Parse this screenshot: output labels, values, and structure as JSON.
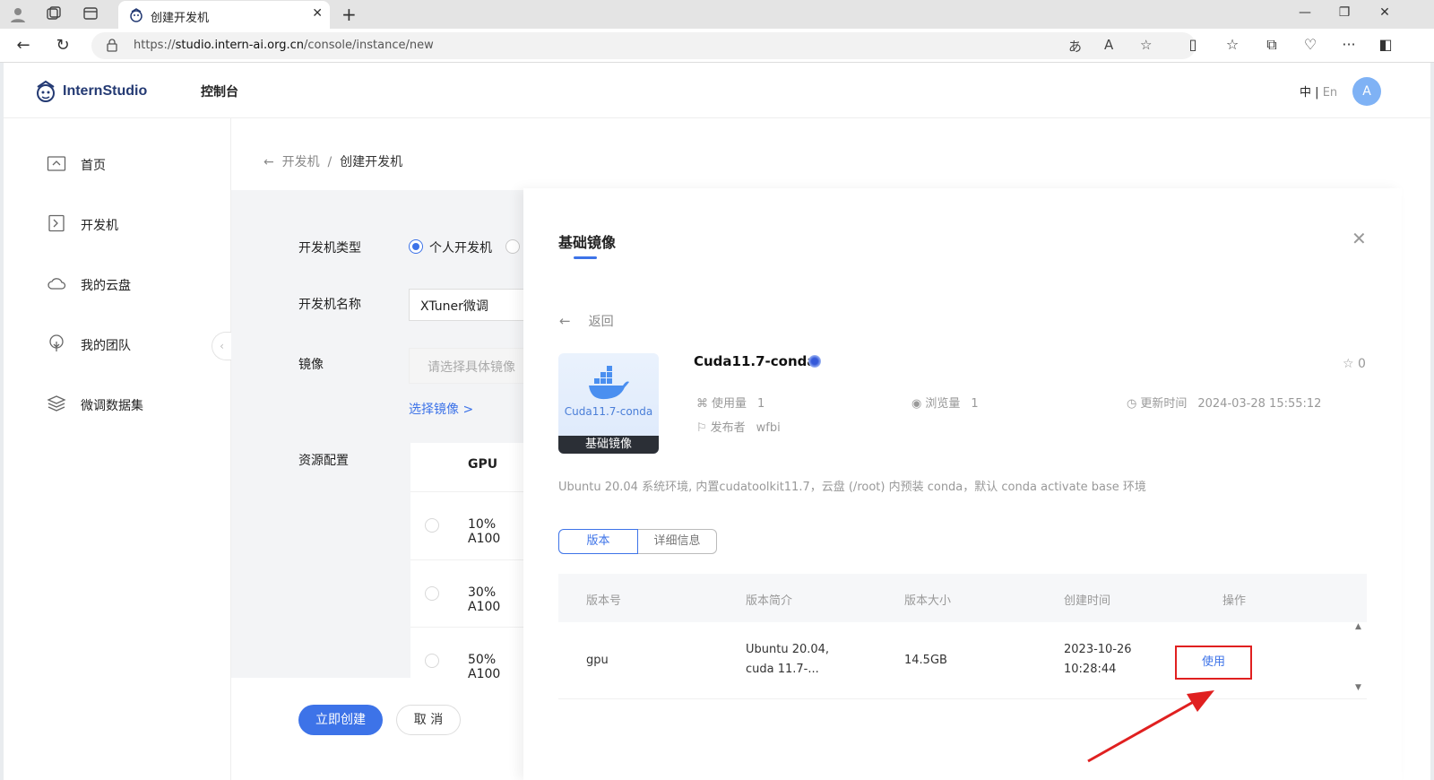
{
  "browser": {
    "tab_title": "创建开发机",
    "url_prefix": "https://",
    "url_host": "studio.intern-ai.org.cn",
    "url_path": "/console/instance/new"
  },
  "header": {
    "logo_text": "InternStudio",
    "console_label": "控制台",
    "lang_zh": "中",
    "lang_sep": "|",
    "lang_en": "En",
    "avatar_letter": "A"
  },
  "sidebar": {
    "items": [
      {
        "label": "首页",
        "icon": "home-icon"
      },
      {
        "label": "开发机",
        "icon": "terminal-icon"
      },
      {
        "label": "我的云盘",
        "icon": "cloud-icon"
      },
      {
        "label": "我的团队",
        "icon": "team-icon"
      },
      {
        "label": "微调数据集",
        "icon": "dataset-icon"
      }
    ]
  },
  "breadcrumb": {
    "back_arrow": "←",
    "parent": "开发机",
    "sep": "/",
    "current": "创建开发机"
  },
  "form": {
    "type_label": "开发机类型",
    "type_option_personal": "个人开发机",
    "name_label": "开发机名称",
    "name_value": "XTuner微调",
    "image_label": "镜像",
    "image_placeholder": "请选择具体镜像",
    "select_image_link": "选择镜像 >",
    "resource_label": "资源配置",
    "gpu_header": "GPU",
    "gpu_options": [
      "10% A100",
      "30% A100",
      "50% A100"
    ],
    "create_button": "立即创建",
    "cancel_button": "取 消"
  },
  "drawer": {
    "title": "基础镜像",
    "back_label": "返回",
    "image_card_label": "Cuda11.7-conda",
    "image_card_tag": "基础镜像",
    "image_name": "Cuda11.7-conda",
    "star_count": "0",
    "usage_label": "使用量",
    "usage_value": "1",
    "views_label": "浏览量",
    "views_value": "1",
    "updated_label": "更新时间",
    "updated_value": "2024-03-28 15:55:12",
    "publisher_label": "发布者",
    "publisher_value": "wfbi",
    "description": "Ubuntu 20.04 系统环境, 内置cudatoolkit11.7，云盘 (/root) 内预装 conda，默认 conda activate base 环境",
    "tabs": [
      "版本",
      "详细信息"
    ],
    "table_headers": [
      "版本号",
      "版本简介",
      "版本大小",
      "创建时间",
      "操作"
    ],
    "rows": [
      {
        "version": "gpu",
        "summary_line1": "Ubuntu 20.04,",
        "summary_line2": "cuda 11.7-...",
        "size": "14.5GB",
        "created_date": "2023-10-26",
        "created_time": "10:28:44",
        "action": "使用"
      }
    ]
  },
  "colors": {
    "primary": "#3d73e8",
    "annotation_red": "#e02020"
  }
}
